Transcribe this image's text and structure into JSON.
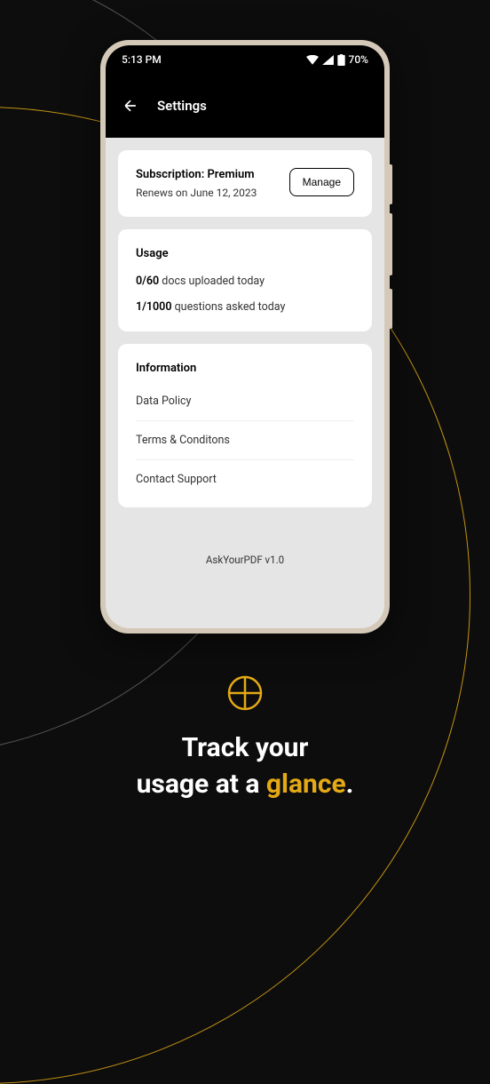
{
  "status_bar": {
    "time": "5:13 PM",
    "battery": "70%"
  },
  "header": {
    "title": "Settings"
  },
  "subscription": {
    "title": "Subscription: Premium",
    "subtitle": "Renews on June 12, 2023",
    "manage_label": "Manage"
  },
  "usage": {
    "title": "Usage",
    "docs_count": "0/60",
    "docs_label": " docs  uploaded today",
    "questions_count": "1/1000",
    "questions_label": " questions  asked today"
  },
  "information": {
    "title": "Information",
    "items": {
      "data_policy": "Data Policy",
      "terms": "Terms & Conditons",
      "contact": "Contact Support"
    }
  },
  "version": "AskYourPDF v1.0",
  "tagline": {
    "line1": "Track  your",
    "line2_start": "usage at a ",
    "line2_accent": "glance",
    "line2_end": "."
  }
}
